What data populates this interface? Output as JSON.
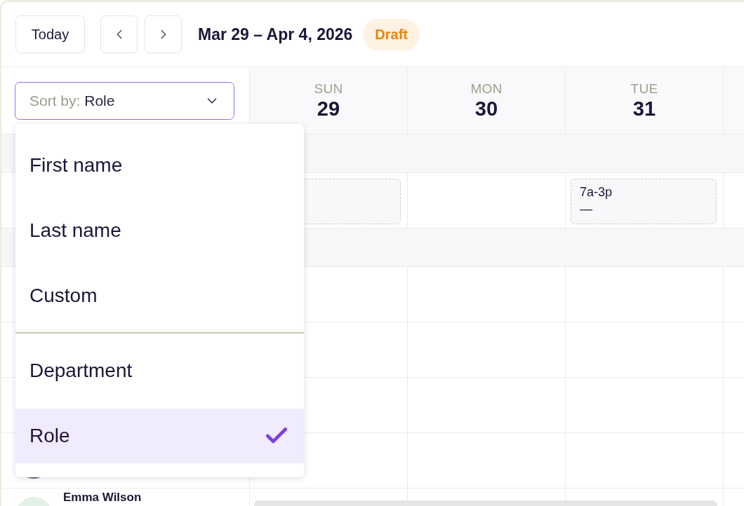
{
  "toolbar": {
    "today_button": "Today",
    "date_range": "Mar 29 – Apr 4, 2026",
    "status_badge": "Draft"
  },
  "sort_select": {
    "label": "Sort by:",
    "value": "Role",
    "expanded": true
  },
  "sort_menu": {
    "sections": [
      {
        "items": [
          {
            "label": "First name",
            "selected": false
          },
          {
            "label": "Last name",
            "selected": false
          },
          {
            "label": "Custom",
            "selected": false
          }
        ]
      },
      {
        "items": [
          {
            "label": "Department",
            "selected": false
          },
          {
            "label": "Role",
            "selected": true
          }
        ]
      }
    ]
  },
  "days": [
    {
      "weekday": "SUN",
      "date": "29"
    },
    {
      "weekday": "MON",
      "date": "30"
    },
    {
      "weekday": "TUE",
      "date": "31"
    }
  ],
  "rows": [
    {
      "kind": "group"
    },
    {
      "kind": "shifts",
      "cells": [
        {
          "kind": "open"
        },
        {
          "kind": "empty"
        },
        {
          "kind": "open",
          "time": "7a-3p",
          "note": "—"
        }
      ]
    },
    {
      "kind": "group"
    },
    {
      "kind": "employee"
    },
    {
      "kind": "employee"
    },
    {
      "kind": "employee"
    },
    {
      "kind": "employee",
      "color": "#6f6284"
    },
    {
      "kind": "employee",
      "name": "Emma Wilson",
      "color": "#e3f1e6",
      "bar": true
    }
  ]
}
